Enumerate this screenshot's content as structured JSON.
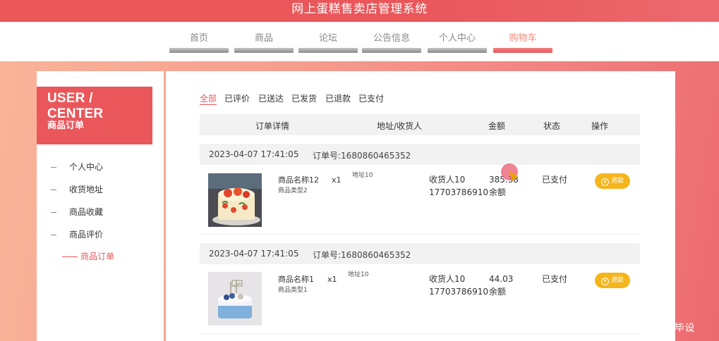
{
  "app": {
    "title": "网上蛋糕售卖店管理系统"
  },
  "nav": {
    "items": [
      {
        "label": "首页",
        "active": false
      },
      {
        "label": "商品",
        "active": false
      },
      {
        "label": "论坛",
        "active": false
      },
      {
        "label": "公告信息",
        "active": false
      },
      {
        "label": "个人中心",
        "active": false
      },
      {
        "label": "购物车",
        "active": true
      }
    ]
  },
  "sidebar": {
    "title": "USER / CENTER",
    "subtitle": "商品订单",
    "items": [
      {
        "label": "个人中心",
        "active": false
      },
      {
        "label": "收货地址",
        "active": false
      },
      {
        "label": "商品收藏",
        "active": false
      },
      {
        "label": "商品评价",
        "active": false
      },
      {
        "label": "商品订单",
        "active": true
      }
    ]
  },
  "tabs": [
    {
      "label": "全部",
      "active": true
    },
    {
      "label": "已评价",
      "active": false
    },
    {
      "label": "已送达",
      "active": false
    },
    {
      "label": "已发货",
      "active": false
    },
    {
      "label": "已退款",
      "active": false
    },
    {
      "label": "已支付",
      "active": false
    }
  ],
  "table": {
    "headers": [
      "订单详情",
      "地址/收货人",
      "金额",
      "状态",
      "操作"
    ]
  },
  "orders": [
    {
      "time": "2023-04-07 17:41:05",
      "order_no": "订单号:1680860465352",
      "product_name": "商品名称12",
      "product_type": "商品类型2",
      "qty": "x1",
      "address": "地址10",
      "receiver": "收货人10",
      "phone": "17703786910",
      "amount": "385.38",
      "pay_method": "余额",
      "status": "已支付",
      "action": "退款"
    },
    {
      "time": "2023-04-07 17:41:05",
      "order_no": "订单号:1680860465352",
      "product_name": "商品名称1",
      "product_type": "商品类型1",
      "qty": "x1",
      "address": "地址10",
      "receiver": "收货人10",
      "phone": "17703786910",
      "amount": "44.03",
      "pay_method": "余额",
      "status": "已支付",
      "action": "退款"
    }
  ],
  "icons": {
    "refund": "yen-circle-icon"
  },
  "colors": {
    "accent": "#e9575b",
    "button": "#f5b51c"
  },
  "watermark": "CSDN @一点毕设"
}
